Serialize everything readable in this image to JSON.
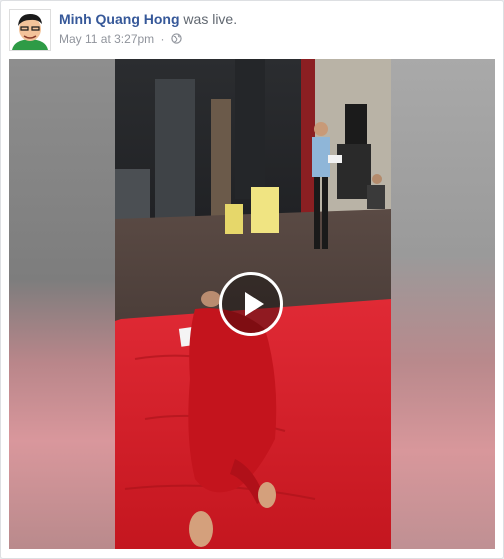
{
  "post": {
    "author_name": "Minh Quang Hong",
    "action_text": "was live.",
    "timestamp": "May 11 at 3:27pm",
    "separator": "·",
    "audience_icon": "globe-icon"
  },
  "video": {
    "play_icon": "play-icon"
  },
  "colors": {
    "author_link": "#365899",
    "meta_text": "#90949c",
    "mat_red": "#d81e2a"
  }
}
